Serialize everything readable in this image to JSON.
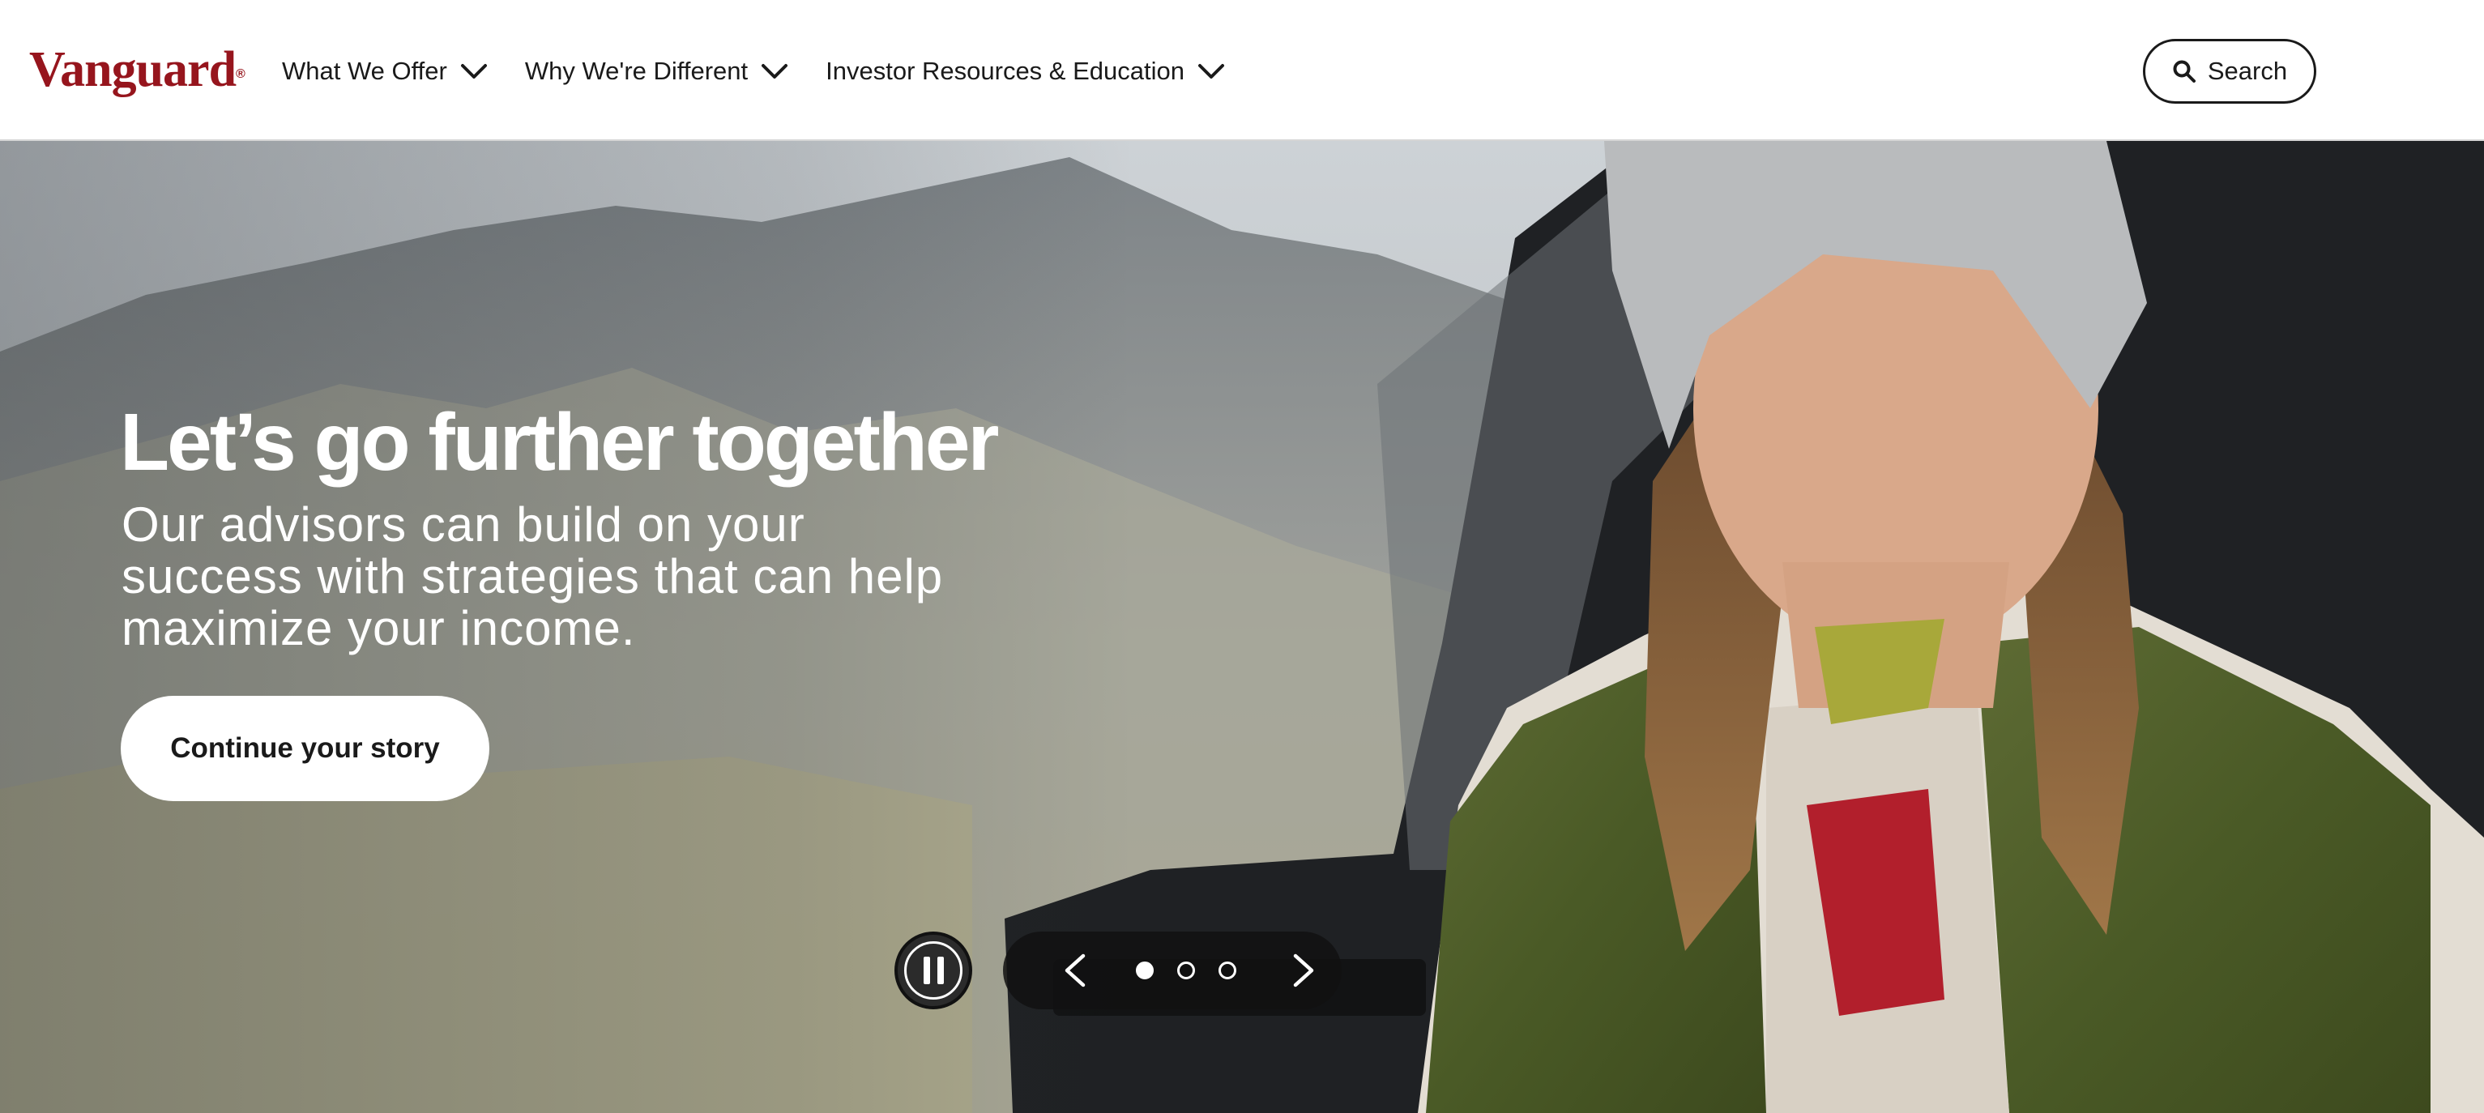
{
  "header": {
    "logo_text": "Vanguard",
    "logo_mark": "®",
    "nav": [
      {
        "label": "What We Offer",
        "icon": "chevron-down-icon"
      },
      {
        "label": "Why We're Different",
        "icon": "chevron-down-icon"
      },
      {
        "label": "Investor Resources & Education",
        "icon": "chevron-down-icon"
      }
    ],
    "search": {
      "label": "Search",
      "icon": "search-icon"
    }
  },
  "hero": {
    "title": "Let’s go further together",
    "subtitle": "Our advisors can build on your success with strategies that can help maximize your income.",
    "cta_label": "Continue your story",
    "carousel": {
      "slide_count": 3,
      "active_index": 0,
      "pause_icon": "pause-icon",
      "prev_icon": "chevron-left-icon",
      "next_icon": "chevron-right-icon"
    }
  },
  "colors": {
    "brand": "#96151d",
    "text": "#1a1a1a",
    "hero_text": "#ffffff",
    "control_bg": "#121212"
  }
}
